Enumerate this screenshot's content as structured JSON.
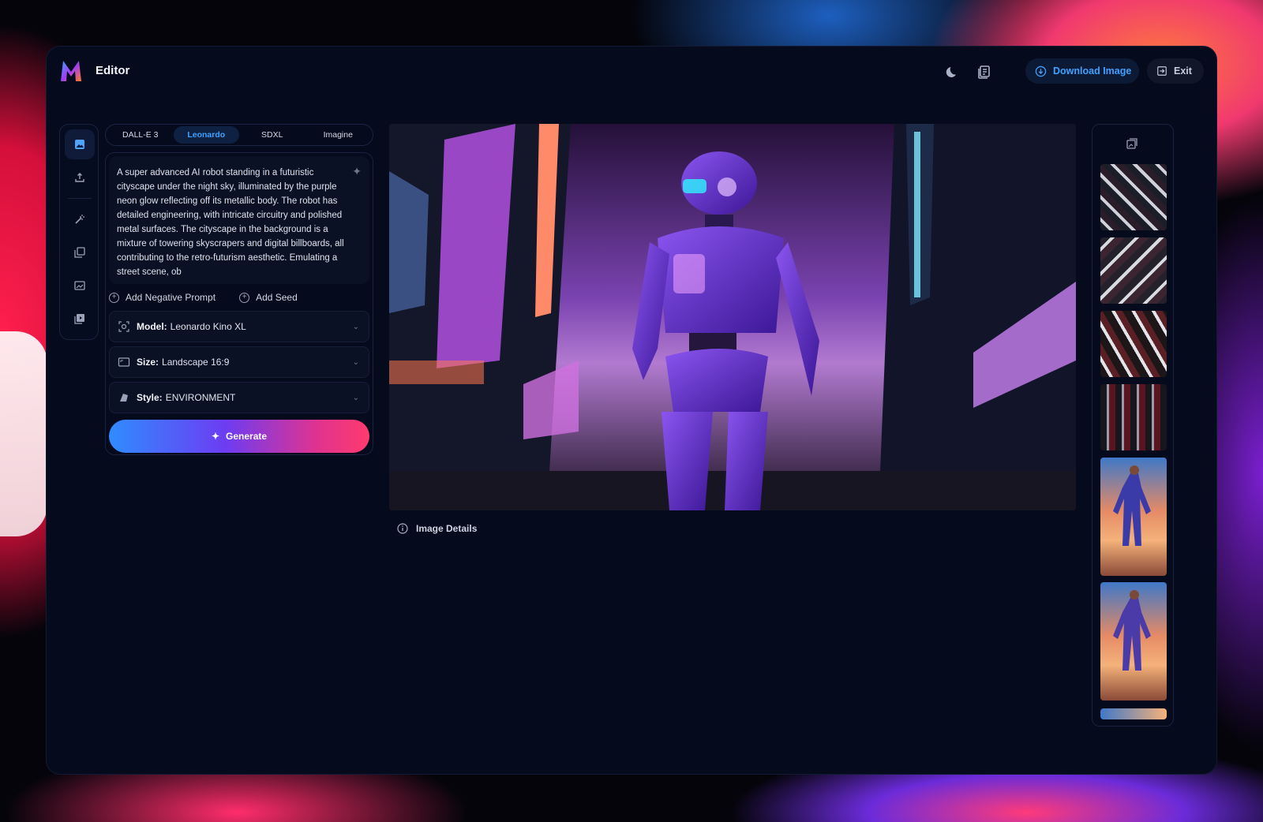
{
  "app": {
    "title": "Editor"
  },
  "header": {
    "download_label": "Download Image",
    "exit_label": "Exit"
  },
  "model_tabs": [
    {
      "label": "DALL-E 3",
      "active": false
    },
    {
      "label": "Leonardo",
      "active": true
    },
    {
      "label": "SDXL",
      "active": false
    },
    {
      "label": "Imagine",
      "active": false
    }
  ],
  "prompt": {
    "text": "A super advanced AI robot standing in a futuristic cityscape under the night sky, illuminated by the purple neon glow reflecting off its metallic body. The robot has detailed engineering, with intricate circuitry and polished metal surfaces. The cityscape in the background is a mixture of towering skyscrapers and digital billboards, all contributing to the retro-futurism aesthetic. Emulating a street scene, ob"
  },
  "prompt_actions": {
    "negative": "Add Negative Prompt",
    "seed": "Add Seed"
  },
  "settings": {
    "model": {
      "label": "Model:",
      "value": "Leonardo Kino XL"
    },
    "size": {
      "label": "Size:",
      "value": "Landscape 16:9"
    },
    "style": {
      "label": "Style:",
      "value": "ENVIRONMENT"
    }
  },
  "generate_label": "Generate",
  "image_details_label": "Image Details",
  "colors": {
    "accent": "#3fa2ff",
    "panel": "#050a1c",
    "robot": "#6a2fd0"
  }
}
